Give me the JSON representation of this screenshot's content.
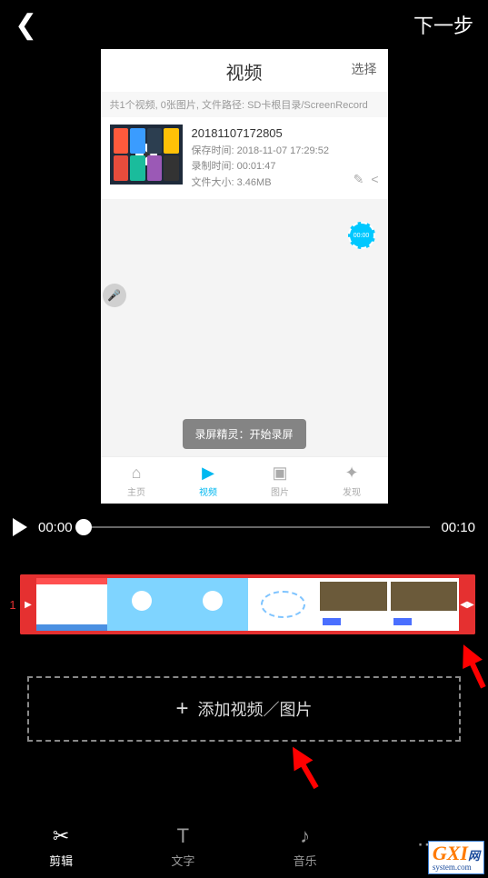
{
  "topbar": {
    "next": "下一步"
  },
  "preview": {
    "title": "视频",
    "select": "选择",
    "subtitle": "共1个视频, 0张图片, 文件路径: SD卡根目录/ScreenRecord",
    "video": {
      "name": "20181107172805",
      "save_time_label": "保存时间:",
      "save_time": "2018-11-07 17:29:52",
      "rec_time_label": "录制时间:",
      "rec_time": "00:01:47",
      "size_label": "文件大小:",
      "size": "3.46MB"
    },
    "timer": "00:00",
    "toast": "录屏精灵：开始录屏",
    "tabs": [
      "主页",
      "视频",
      "图片",
      "发现"
    ]
  },
  "playback": {
    "current": "00:00",
    "total": "00:10"
  },
  "timeline": {
    "track_number": "1"
  },
  "add_box": {
    "label": "添加视频／图片"
  },
  "bottom_tabs": {
    "items": [
      {
        "label": "剪辑"
      },
      {
        "label": "文字"
      },
      {
        "label": "音乐"
      },
      {
        "label": ""
      }
    ]
  },
  "watermark": {
    "brand": "GXI",
    "suffix": "网",
    "sub": "system.com"
  }
}
